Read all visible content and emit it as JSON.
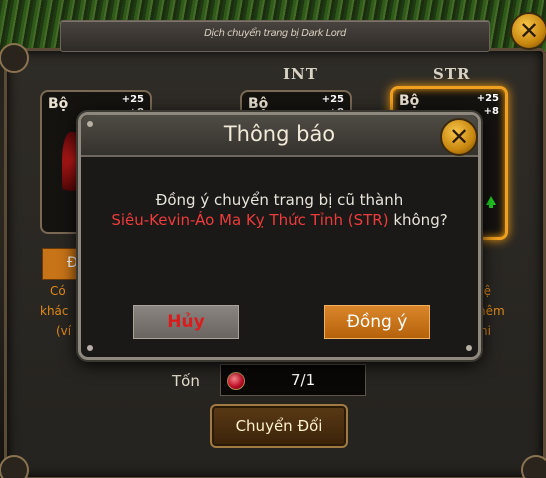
{
  "window": {
    "title": "Dịch chuyển trang bị Dark Lord",
    "close_icon": "close-icon"
  },
  "columns": {
    "int_label": "INT",
    "str_label": "STR"
  },
  "cards": [
    {
      "type_label": "Bộ",
      "plus_top": "+25",
      "plus_bottom": "+8"
    },
    {
      "type_label": "Bộ",
      "plus_top": "+25",
      "plus_bottom": "+8"
    },
    {
      "type_label": "Bộ",
      "plus_top": "+25",
      "plus_bottom": "+8"
    }
  ],
  "side_left": {
    "button_label": "Đ",
    "line1": "Có",
    "line2": "khác",
    "line3": "(ví"
  },
  "side_right": {
    "line1": "hệ",
    "line2": "hêm",
    "line3": "hi"
  },
  "cost": {
    "label": "Tốn",
    "value": "7/1"
  },
  "convert_button": "Chuyển Đổi",
  "dialog": {
    "title": "Thông báo",
    "message_line1": "Đồng ý chuyển trang bị cũ thành",
    "item_name": "Siêu-Kevin-Áo Ma Kỵ Thức Tỉnh (STR)",
    "message_suffix": " không?",
    "cancel_label": "Hủy",
    "confirm_label": "Đồng ý"
  },
  "colors": {
    "accent_orange": "#f0a020",
    "item_red": "#ee3b3b",
    "gold": "#c8860e"
  }
}
